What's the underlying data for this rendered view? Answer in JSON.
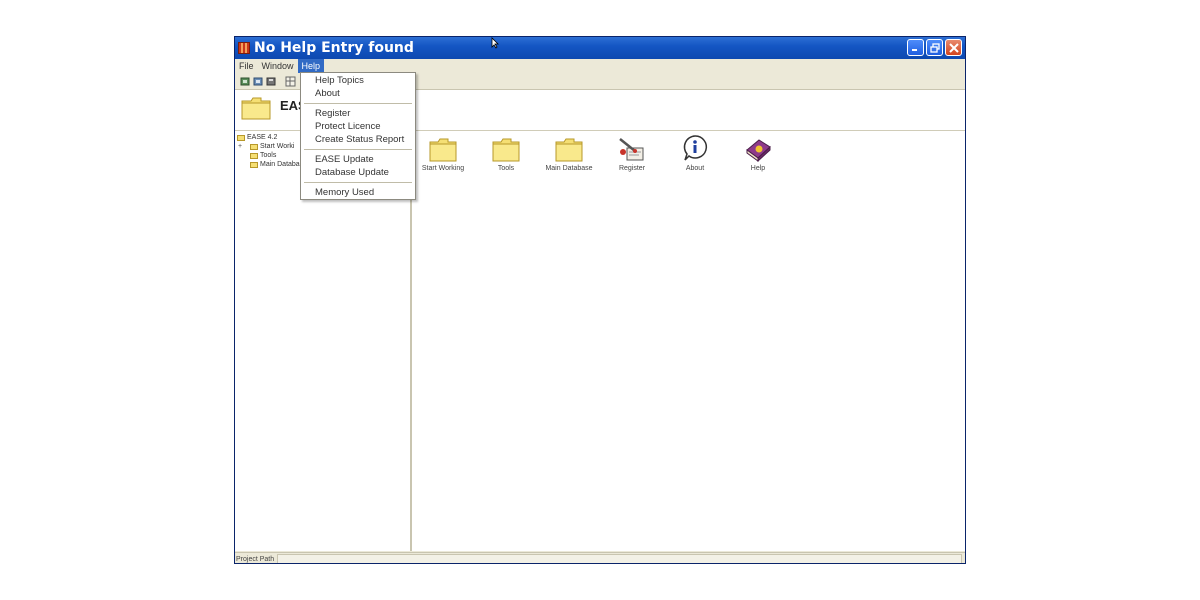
{
  "window": {
    "title": "No Help Entry found"
  },
  "menubar": {
    "items": [
      "File",
      "Window",
      "Help"
    ],
    "active": "Help"
  },
  "header": {
    "title": "EAS"
  },
  "tree": {
    "root": "EASE 4.2",
    "children": [
      "Start Worki",
      "Tools",
      "Main Databa"
    ]
  },
  "icons": [
    {
      "label": "Start Working",
      "icon": "folder-icon"
    },
    {
      "label": "Tools",
      "icon": "folder-icon"
    },
    {
      "label": "Main Database",
      "icon": "folder-icon"
    },
    {
      "label": "Register",
      "icon": "register-icon"
    },
    {
      "label": "About",
      "icon": "info-icon"
    },
    {
      "label": "Help",
      "icon": "help-book-icon"
    }
  ],
  "help_menu": {
    "group1": [
      "Help Topics",
      "About"
    ],
    "group2": [
      "Register",
      "Protect Licence",
      "Create Status Report"
    ],
    "group3": [
      "EASE Update",
      "Database Update"
    ],
    "group4": [
      "Memory Used"
    ]
  },
  "statusbar": {
    "label": "Project Path"
  },
  "colors": {
    "titlebar": "#1456c4",
    "menu_highlight": "#316ac5",
    "folder": "#f5df74"
  }
}
